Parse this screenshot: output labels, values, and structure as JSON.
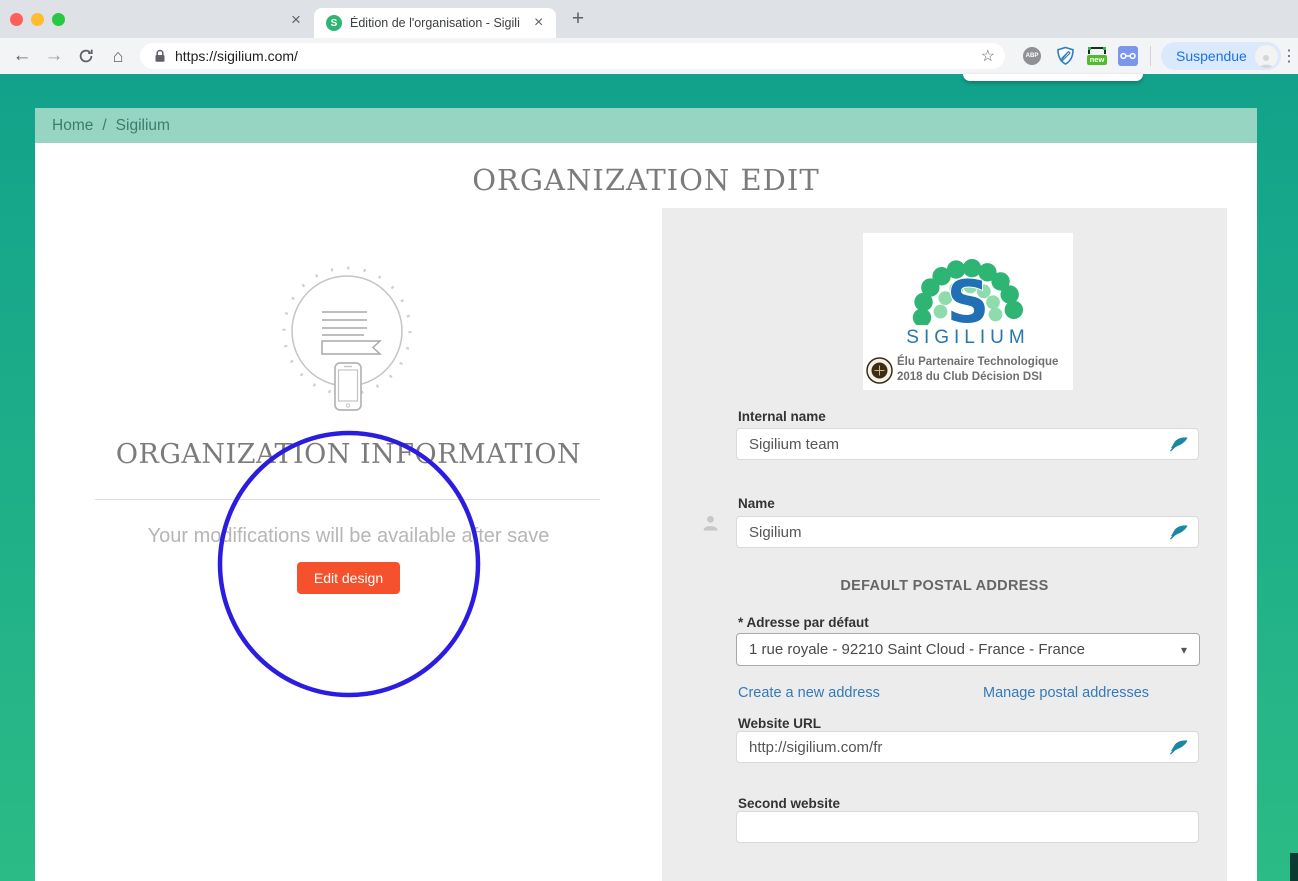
{
  "browser": {
    "tab": {
      "title": "Édition de l'organisation - Sigili",
      "favicon_letter": "S"
    },
    "url": "https://sigilium.com/",
    "profile_label": "Suspendue",
    "extensions": {
      "abp_label": "ABP",
      "new_badge_label": "new"
    },
    "icons": {
      "back": "←",
      "forward": "→",
      "home": "⌂",
      "star": "☆",
      "close": "×",
      "plus": "+",
      "menu_dots": "⋮",
      "caret": "▾"
    }
  },
  "breadcrumb": {
    "home": "Home",
    "separator": "/",
    "current": "Sigilium"
  },
  "page": {
    "title": "ORGANIZATION EDIT"
  },
  "left_panel": {
    "heading": "ORGANIZATION INFORMATION",
    "note": "Your modifications will be available after save",
    "edit_design_button": "Edit design"
  },
  "right_panel": {
    "logo": {
      "brand": "SIGILIUM",
      "badge_line1": "Élu Partenaire Technologique",
      "badge_line2": "2018 du Club Décision DSI"
    },
    "fields": {
      "internal_name": {
        "label": "Internal name",
        "value": "Sigilium team"
      },
      "name": {
        "label": "Name",
        "value": "Sigilium"
      },
      "postal_heading": "DEFAULT POSTAL ADDRESS",
      "default_address": {
        "label": "* Adresse par défaut",
        "value": "1 rue royale - 92210 Saint Cloud - France - France"
      },
      "links": {
        "create": "Create a new address",
        "manage": "Manage postal addresses"
      },
      "website": {
        "label": "Website URL",
        "value": "http://sigilium.com/fr"
      },
      "second_website": {
        "label": "Second website",
        "value": ""
      }
    }
  },
  "colors": {
    "accent_orange": "#f4512c",
    "brand_teal": "#12a28b",
    "breadcrumb_bg": "#95d5c1",
    "link_blue": "#337ab7",
    "logo_green": "#2eb573",
    "logo_blue": "#1f70b5",
    "annotation_blue": "#2b1de0",
    "pen_icon_teal": "#1b87a3"
  }
}
